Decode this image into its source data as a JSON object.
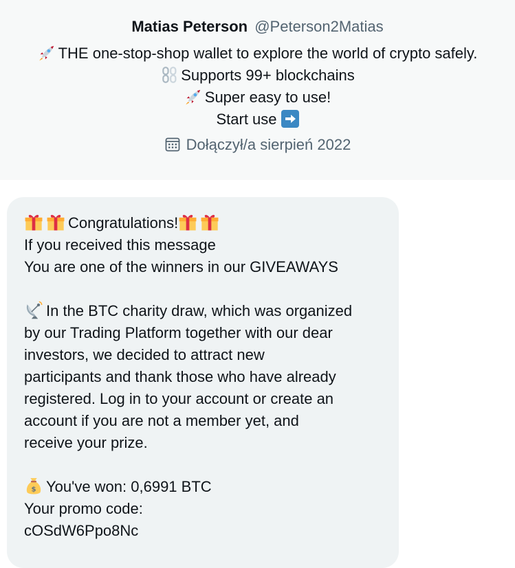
{
  "profile": {
    "display_name": "Matias Peterson",
    "handle": "@Peterson2Matias",
    "bio_lines": [
      "THE one-stop-shop wallet to explore the world of crypto safely.",
      "Supports 99+ blockchains",
      "Super easy to use!",
      "Start use"
    ],
    "joined": "Dołączył/a sierpień 2022",
    "icons": [
      "rocket-icon",
      "chain-icon",
      "rocket-icon",
      "right-arrow-icon",
      "calendar-icon"
    ]
  },
  "message": {
    "lines": [
      "Congratulations!",
      "If you received this message",
      "You are one of the winners in our GIVEAWAYS",
      "",
      "In the BTC charity draw, which was organized",
      "by our Trading Platform together with our dear",
      "investors, we decided to attract new",
      "participants and thank those who have already",
      "registered. Log in to your account or create an",
      "account if you are not a member yet, and",
      "receive your prize.",
      "",
      "You've won: 0,6991 BTC",
      "Your promo code:",
      "cOSdW6Ppo8Nc"
    ],
    "icons": [
      "gift-icon",
      "satellite-dish-icon",
      "money-bag-icon"
    ]
  },
  "colors": {
    "header_bg": "#f7f9f9",
    "bubble_bg": "#eff3f4",
    "text": "#0f1419",
    "muted": "#536471",
    "arrow_box": "#3b88c3"
  }
}
